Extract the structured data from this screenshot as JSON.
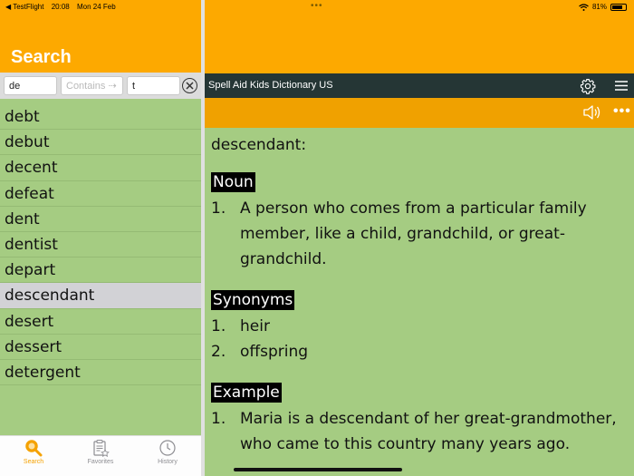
{
  "status_bar": {
    "carrier": "◀ TestFlight",
    "time": "20:08",
    "date": "Mon 24 Feb",
    "multitask_dots": "•••",
    "battery_percent": "81%",
    "battery_level": 0.81
  },
  "left_header": {
    "title": "Search"
  },
  "search": {
    "starts_with_value": "de",
    "contains_placeholder": "Contains ⇢",
    "ends_with_value": "t"
  },
  "word_list": [
    "debt",
    "debut",
    "decent",
    "defeat",
    "dent",
    "dentist",
    "depart",
    "descendant",
    "desert",
    "dessert",
    "detergent"
  ],
  "selected_word_index": 7,
  "tabs": [
    {
      "label": "Search",
      "icon": "magnifier-icon",
      "active": true
    },
    {
      "label": "Favorites",
      "icon": "clipboard-star-icon",
      "active": false
    },
    {
      "label": "History",
      "icon": "clock-icon",
      "active": false
    }
  ],
  "nav": {
    "title": "Spell Aid Kids Dictionary US",
    "settings_icon": "gear-icon",
    "menu_icon": "hamburger-icon"
  },
  "toolbar": {
    "speaker_icon": "speaker-icon",
    "more_label": "•••"
  },
  "entry": {
    "headword": "descendant:",
    "sections": [
      {
        "label": "Noun",
        "items": [
          "A person who comes from a particular family member, like a child, grandchild, or great-grandchild."
        ]
      },
      {
        "label": "Synonyms",
        "items": [
          "heir",
          "offspring"
        ]
      },
      {
        "label": "Example",
        "items": [
          "Maria is a descendant of her great-grandmother, who came to this country many years ago."
        ]
      }
    ]
  },
  "colors": {
    "accent": "#fda900",
    "content_bg": "#a5cc82",
    "nav_bg": "#253635",
    "selection": "#d2d2d6"
  }
}
